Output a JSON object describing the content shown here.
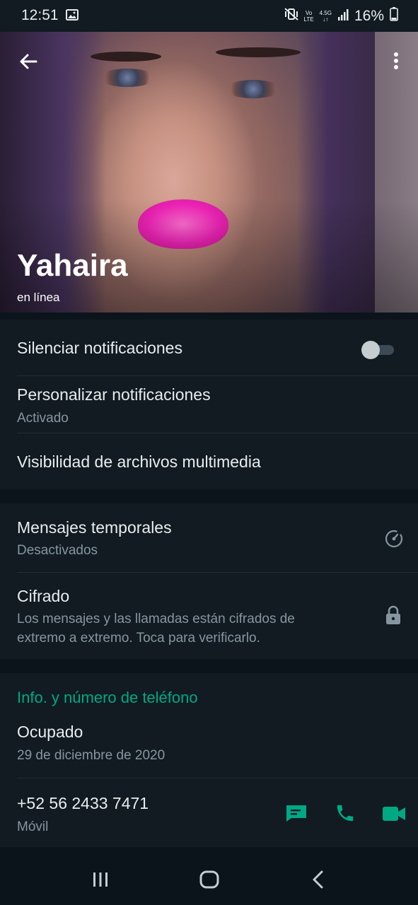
{
  "status_bar": {
    "time": "12:51",
    "network_top": "Vo",
    "network_bottom": "LTE",
    "gen": "4.5G",
    "battery": "16%"
  },
  "profile": {
    "name": "Yahaira",
    "presence": "en línea"
  },
  "notifications": {
    "mute_label": "Silenciar notificaciones",
    "mute_enabled": false,
    "custom_label": "Personalizar notificaciones",
    "custom_value": "Activado",
    "media_visibility_label": "Visibilidad de archivos multimedia"
  },
  "privacy": {
    "disappearing_label": "Mensajes temporales",
    "disappearing_value": "Desactivados",
    "encryption_label": "Cifrado",
    "encryption_line1": "Los mensajes y las llamadas están cifrados de",
    "encryption_line2": "extremo a extremo. Toca para verificarlo."
  },
  "info": {
    "section_title": "Info. y número de teléfono",
    "about": "Ocupado",
    "about_date": "29 de diciembre de 2020",
    "phone": "+52 56 2433 7471",
    "phone_type": "Móvil"
  },
  "colors": {
    "accent": "#00a884",
    "background": "#0b141a",
    "card": "#111b21",
    "secondary_text": "#8696a0"
  },
  "icons": {
    "back": "back-arrow-icon",
    "more": "more-vert-icon",
    "timer": "timer-icon",
    "lock": "lock-icon",
    "message": "message-icon",
    "call": "phone-icon",
    "video": "video-call-icon"
  }
}
